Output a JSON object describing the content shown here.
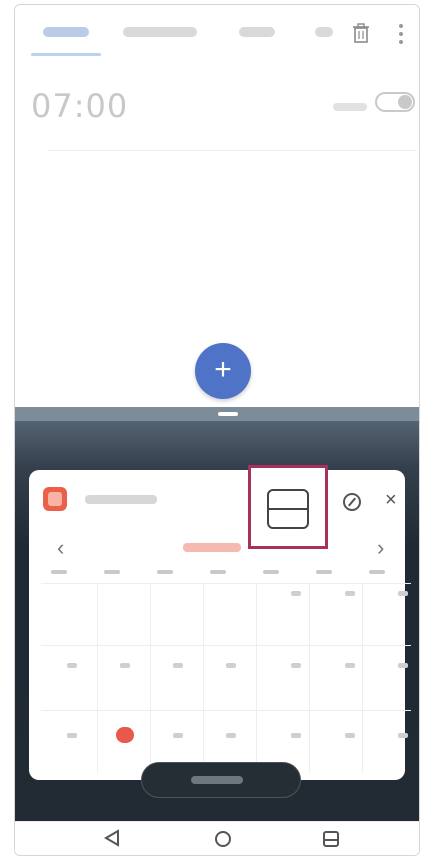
{
  "alarm": {
    "time": "07:00",
    "enabled": false
  },
  "icons": {
    "add": "plus-icon",
    "delete": "trash-icon",
    "more": "more-vertical-icon",
    "split": "split-screen-icon",
    "edit": "edit-icon",
    "close": "close-icon",
    "prev": "chevron-left-icon",
    "next": "chevron-right-icon",
    "nav_back": "back-triangle-icon",
    "nav_home": "home-circle-icon",
    "nav_recents": "recents-square-icon"
  },
  "symbols": {
    "plus": "+",
    "close": "×",
    "prev": "‹",
    "next": "›"
  },
  "colors": {
    "accent_blue": "#4f74c7",
    "calendar_red": "#e9594a",
    "highlight_box": "#a7315c"
  }
}
